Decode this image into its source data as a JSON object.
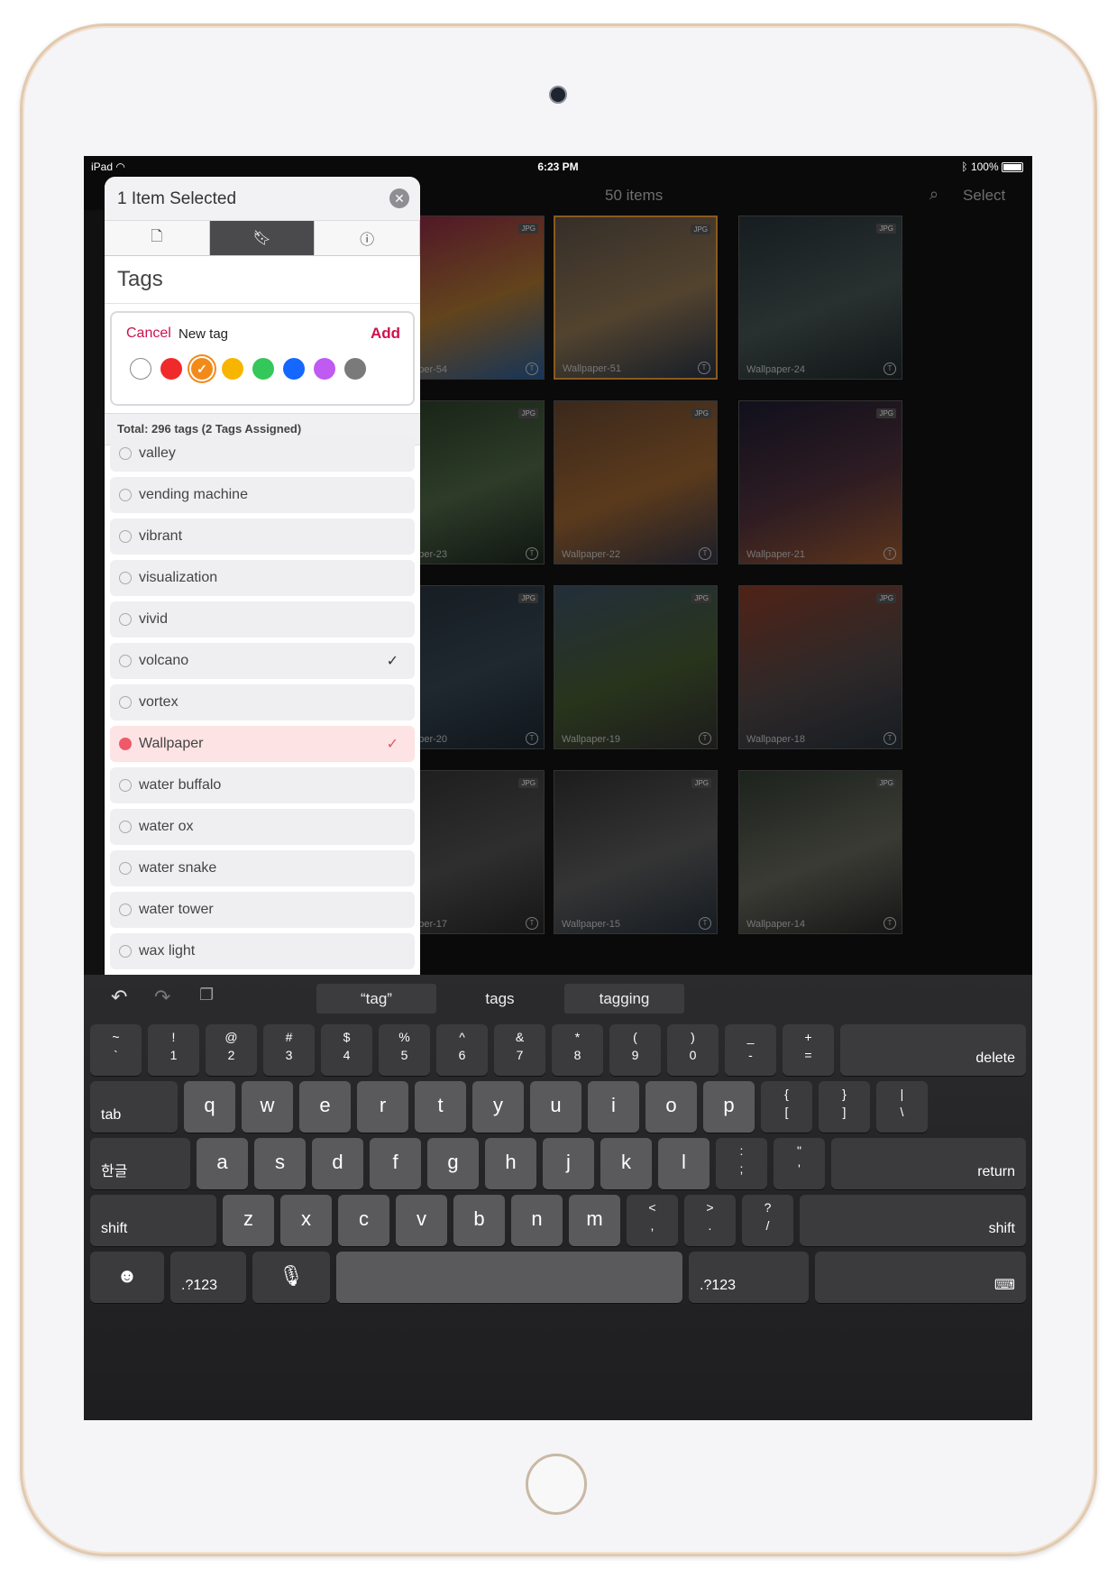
{
  "status": {
    "device": "iPad",
    "time": "6:23 PM",
    "battery": "100%"
  },
  "grid": {
    "title": "50 items",
    "select_label": "Select",
    "items": [
      {
        "name": "Wallpaper-54",
        "badge": "JPG",
        "colors": [
          "#c21f5b",
          "#f2a23b",
          "#2a7bd6"
        ]
      },
      {
        "name": "Wallpaper-51",
        "badge": "JPG",
        "colors": [
          "#7d6a5a",
          "#c9a16b",
          "#2a3e5a"
        ],
        "selected": true
      },
      {
        "name": "Wallpaper-24",
        "badge": "JPG",
        "colors": [
          "#2a3a44",
          "#5b6f6c",
          "#1e2a2e"
        ]
      },
      {
        "name": "Wallpaper-23",
        "badge": "JPG",
        "colors": [
          "#2b4a2a",
          "#678c5a",
          "#1a2a1e"
        ]
      },
      {
        "name": "Wallpaper-22",
        "badge": "JPG",
        "colors": [
          "#8b5a3a",
          "#e0893a",
          "#3b3f5a"
        ]
      },
      {
        "name": "Wallpaper-21",
        "badge": "JPG",
        "colors": [
          "#1a1a3a",
          "#6b3a4a",
          "#e07a3a"
        ]
      },
      {
        "name": "Wallpaper-20",
        "badge": "JPG",
        "colors": [
          "#2a3a4a",
          "#3e5a6a",
          "#1a2a3a"
        ]
      },
      {
        "name": "Wallpaper-19",
        "badge": "JPG",
        "colors": [
          "#4a6a8a",
          "#5a7a3a",
          "#3a3a3a"
        ]
      },
      {
        "name": "Wallpaper-18",
        "badge": "JPG",
        "colors": [
          "#c24a2a",
          "#6a5a5a",
          "#2a3a4a"
        ]
      },
      {
        "name": "Wallpaper-17",
        "badge": "JPG",
        "colors": [
          "#3a3a3a",
          "#6a6a6a",
          "#2a2a2a"
        ]
      },
      {
        "name": "Wallpaper-15",
        "badge": "JPG",
        "colors": [
          "#3a3a3a",
          "#7a7a7a",
          "#2a3a4a"
        ]
      },
      {
        "name": "Wallpaper-14",
        "badge": "JPG",
        "colors": [
          "#3a4a3a",
          "#8a8a7a",
          "#2a2a2a"
        ]
      }
    ]
  },
  "popover": {
    "title": "1 Item Selected",
    "close_icon": "close-icon",
    "tabs": [
      {
        "icon": "document-icon"
      },
      {
        "icon": "bookmark-icon",
        "active": true
      },
      {
        "icon": "info-icon"
      }
    ],
    "section_title": "Tags",
    "new_tag": {
      "cancel_label": "Cancel",
      "placeholder": "New tag",
      "add_label": "Add",
      "colors": [
        "#ffffff",
        "#f02a2a",
        "#f28a1a",
        "#f7b500",
        "#34c759",
        "#1467ff",
        "#bf5af2",
        "#7a7a7a"
      ],
      "selected_color_index": 2
    },
    "total_text": "Total: 296 tags (2 Tags Assigned)",
    "tags": [
      {
        "label": "valley",
        "checked": false
      },
      {
        "label": "vending machine",
        "checked": false
      },
      {
        "label": "vibrant",
        "checked": false
      },
      {
        "label": "visualization",
        "checked": false
      },
      {
        "label": "vivid",
        "checked": false
      },
      {
        "label": "volcano",
        "checked": true
      },
      {
        "label": "vortex",
        "checked": false
      },
      {
        "label": "Wallpaper",
        "checked": true,
        "highlighted": true
      },
      {
        "label": "water buffalo",
        "checked": false
      },
      {
        "label": "water ox",
        "checked": false
      },
      {
        "label": "water snake",
        "checked": false
      },
      {
        "label": "water tower",
        "checked": false
      },
      {
        "label": "wax light",
        "checked": false
      }
    ]
  },
  "keyboard": {
    "suggestions": [
      "“tag”",
      "tags",
      "tagging"
    ],
    "row1": [
      [
        "~",
        "`"
      ],
      [
        "!",
        "1"
      ],
      [
        "@",
        "2"
      ],
      [
        "#",
        "3"
      ],
      [
        "$",
        "4"
      ],
      [
        "%",
        "5"
      ],
      [
        "^",
        "6"
      ],
      [
        "&",
        "7"
      ],
      [
        "*",
        "8"
      ],
      [
        "(",
        "9"
      ],
      [
        ")",
        "0"
      ],
      [
        "_",
        "-"
      ],
      [
        "+",
        "="
      ]
    ],
    "delete_label": "delete",
    "tab_label": "tab",
    "row2": [
      "q",
      "w",
      "e",
      "r",
      "t",
      "y",
      "u",
      "i",
      "o",
      "p"
    ],
    "row2_extra": [
      [
        "{",
        "["
      ],
      [
        "}",
        "]"
      ],
      [
        "|",
        "\\"
      ]
    ],
    "lang_label": "한글",
    "row3": [
      "a",
      "s",
      "d",
      "f",
      "g",
      "h",
      "j",
      "k",
      "l"
    ],
    "row3_extra": [
      [
        ":",
        ";"
      ],
      [
        "\"",
        "'"
      ]
    ],
    "return_label": "return",
    "shift_label": "shift",
    "row4": [
      "z",
      "x",
      "c",
      "v",
      "b",
      "n",
      "m"
    ],
    "row4_extra": [
      [
        "<",
        ","
      ],
      [
        ">",
        "."
      ],
      [
        "?",
        "/"
      ]
    ],
    "numbers_label": ".?123"
  }
}
